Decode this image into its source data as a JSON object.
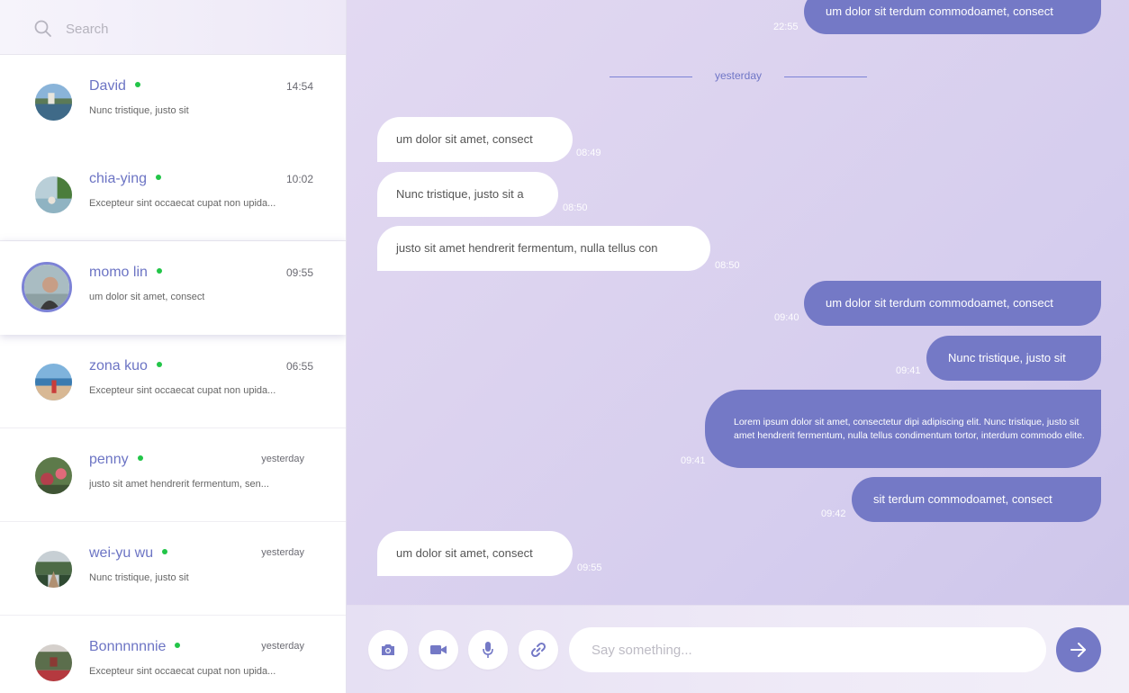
{
  "search": {
    "placeholder": "Search",
    "icon": "search-icon"
  },
  "contacts": [
    {
      "name": "David",
      "time": "14:54",
      "preview": "Nunc tristique, justo sit",
      "online": true
    },
    {
      "name": "chia-ying",
      "time": "10:02",
      "preview": "Excepteur sint occaecat cupat non upida...",
      "online": true
    },
    {
      "name": "momo lin",
      "time": "09:55",
      "preview": "um dolor sit amet, consect",
      "online": true,
      "active": true
    },
    {
      "name": "zona kuo",
      "time": "06:55",
      "preview": "Excepteur sint occaecat cupat non upida...",
      "online": true
    },
    {
      "name": "penny",
      "time": "yesterday",
      "preview": "justo sit amet hendrerit fermentum, sen...",
      "online": true
    },
    {
      "name": "wei-yu wu",
      "time": "yesterday",
      "preview": "Nunc tristique, justo sit",
      "online": true
    },
    {
      "name": "Bonnnnnnie",
      "time": "yesterday",
      "preview": "Excepteur sint occaecat cupat non upida...",
      "online": true
    }
  ],
  "chat": {
    "divider": "yesterday",
    "messages": [
      {
        "dir": "out",
        "text": "um dolor sit terdum commodoamet, consect",
        "time": "22:55"
      },
      {
        "dir": "in",
        "text": "um dolor sit amet, consect",
        "time": "08:49"
      },
      {
        "dir": "in",
        "text": "Nunc tristique, justo sit a",
        "time": "08:50"
      },
      {
        "dir": "in",
        "text": "justo sit amet hendrerit fermentum, nulla tellus con",
        "time": "08:50"
      },
      {
        "dir": "out",
        "text": "um dolor sit terdum commodoamet, consect",
        "time": "09:40"
      },
      {
        "dir": "out",
        "text": "Nunc tristique, justo sit",
        "time": "09:41"
      },
      {
        "dir": "out",
        "text": "Lorem ipsum dolor sit amet, consectetur dipi adipiscing elit. Nunc tristique, justo sit amet hendrerit fermentum, nulla tellus condimentum tortor, interdum commodo elite.",
        "time": "09:41"
      },
      {
        "dir": "out",
        "text": "sit terdum commodoamet, consect",
        "time": "09:42"
      },
      {
        "dir": "in",
        "text": "um dolor sit amet, consect",
        "time": "09:55"
      }
    ]
  },
  "composer": {
    "placeholder": "Say something...",
    "tools": [
      "camera-icon",
      "video-icon",
      "microphone-icon",
      "link-icon"
    ],
    "send_icon": "arrow-right-icon"
  },
  "colors": {
    "accent": "#7479c6",
    "name": "#6c74c4",
    "online": "#22c548"
  }
}
